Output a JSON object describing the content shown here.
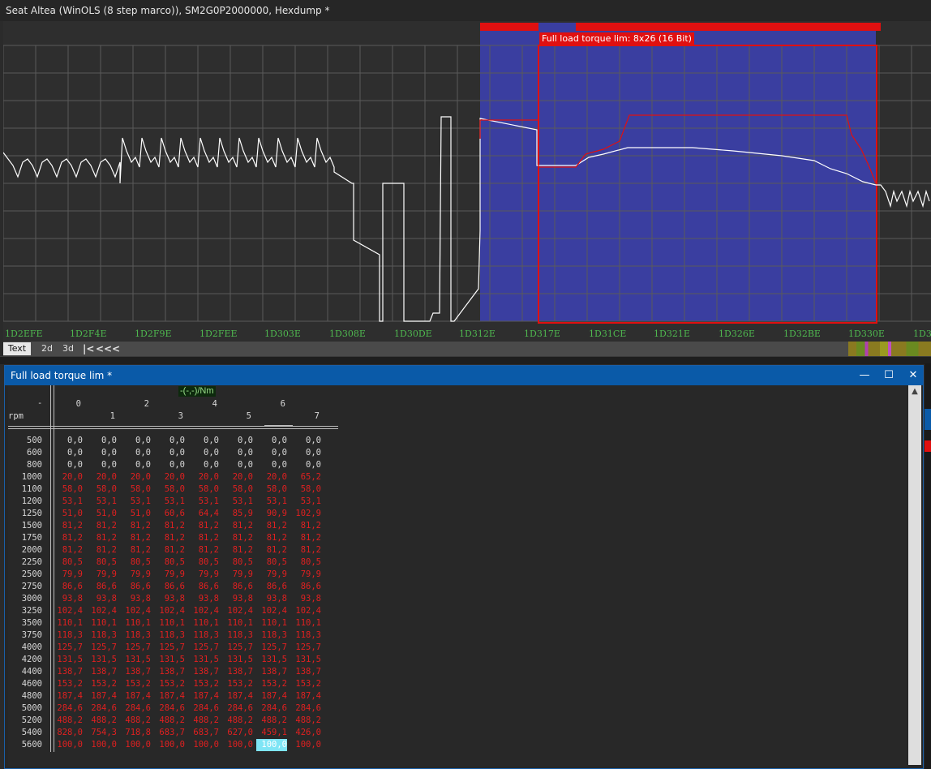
{
  "window_title": "Seat Altea (WinOLS  (8 step marco)), SM2G0P2000000, Hexdump *",
  "hexview": {
    "map_label": "Full load torque lim: 8x26 (16 Bit)",
    "addresses": [
      "1D2EFE",
      "1D2F4E",
      "1D2F9E",
      "1D2FEE",
      "1D303E",
      "1D308E",
      "1D30DE",
      "1D312E",
      "1D317E",
      "1D31CE",
      "1D321E",
      "1D326E",
      "1D32BE",
      "1D330E",
      "1D3"
    ],
    "colors": {
      "selection": "#3a3ea0",
      "map_frame": "#e01010",
      "curve": "#ffffff",
      "grid": "#5a5a5a"
    }
  },
  "view_tabs": {
    "tabs": [
      "Text",
      "2d",
      "3d"
    ],
    "active": "Text",
    "nav": [
      "|<",
      "<<",
      "<"
    ]
  },
  "map_window": {
    "title": "Full load torque lim *",
    "unit": "-(-,-)/Nm",
    "corner": "-",
    "row_axis_label": "rpm",
    "columns_top": [
      "0",
      "2",
      "4",
      "6"
    ],
    "columns_bottom": [
      "1",
      "3",
      "5",
      "7"
    ],
    "buttons": {
      "minimize": "—",
      "maximize": "☐",
      "close": "✕"
    },
    "rows": [
      {
        "rpm": "500",
        "values": [
          "0,0",
          "0,0",
          "0,0",
          "0,0",
          "0,0",
          "0,0",
          "0,0",
          "0,0"
        ],
        "changed": false
      },
      {
        "rpm": "600",
        "values": [
          "0,0",
          "0,0",
          "0,0",
          "0,0",
          "0,0",
          "0,0",
          "0,0",
          "0,0"
        ],
        "changed": false
      },
      {
        "rpm": "800",
        "values": [
          "0,0",
          "0,0",
          "0,0",
          "0,0",
          "0,0",
          "0,0",
          "0,0",
          "0,0"
        ],
        "changed": false
      },
      {
        "rpm": "1000",
        "values": [
          "20,0",
          "20,0",
          "20,0",
          "20,0",
          "20,0",
          "20,0",
          "20,0",
          "65,2"
        ],
        "changed": true
      },
      {
        "rpm": "1100",
        "values": [
          "58,0",
          "58,0",
          "58,0",
          "58,0",
          "58,0",
          "58,0",
          "58,0",
          "58,0"
        ],
        "changed": true
      },
      {
        "rpm": "1200",
        "values": [
          "53,1",
          "53,1",
          "53,1",
          "53,1",
          "53,1",
          "53,1",
          "53,1",
          "53,1"
        ],
        "changed": true
      },
      {
        "rpm": "1250",
        "values": [
          "51,0",
          "51,0",
          "51,0",
          "60,6",
          "64,4",
          "85,9",
          "90,9",
          "102,9"
        ],
        "changed": true
      },
      {
        "rpm": "1500",
        "values": [
          "81,2",
          "81,2",
          "81,2",
          "81,2",
          "81,2",
          "81,2",
          "81,2",
          "81,2"
        ],
        "changed": true
      },
      {
        "rpm": "1750",
        "values": [
          "81,2",
          "81,2",
          "81,2",
          "81,2",
          "81,2",
          "81,2",
          "81,2",
          "81,2"
        ],
        "changed": true
      },
      {
        "rpm": "2000",
        "values": [
          "81,2",
          "81,2",
          "81,2",
          "81,2",
          "81,2",
          "81,2",
          "81,2",
          "81,2"
        ],
        "changed": true
      },
      {
        "rpm": "2250",
        "values": [
          "80,5",
          "80,5",
          "80,5",
          "80,5",
          "80,5",
          "80,5",
          "80,5",
          "80,5"
        ],
        "changed": true
      },
      {
        "rpm": "2500",
        "values": [
          "79,9",
          "79,9",
          "79,9",
          "79,9",
          "79,9",
          "79,9",
          "79,9",
          "79,9"
        ],
        "changed": true
      },
      {
        "rpm": "2750",
        "values": [
          "86,6",
          "86,6",
          "86,6",
          "86,6",
          "86,6",
          "86,6",
          "86,6",
          "86,6"
        ],
        "changed": true
      },
      {
        "rpm": "3000",
        "values": [
          "93,8",
          "93,8",
          "93,8",
          "93,8",
          "93,8",
          "93,8",
          "93,8",
          "93,8"
        ],
        "changed": true
      },
      {
        "rpm": "3250",
        "values": [
          "102,4",
          "102,4",
          "102,4",
          "102,4",
          "102,4",
          "102,4",
          "102,4",
          "102,4"
        ],
        "changed": true
      },
      {
        "rpm": "3500",
        "values": [
          "110,1",
          "110,1",
          "110,1",
          "110,1",
          "110,1",
          "110,1",
          "110,1",
          "110,1"
        ],
        "changed": true
      },
      {
        "rpm": "3750",
        "values": [
          "118,3",
          "118,3",
          "118,3",
          "118,3",
          "118,3",
          "118,3",
          "118,3",
          "118,3"
        ],
        "changed": true
      },
      {
        "rpm": "4000",
        "values": [
          "125,7",
          "125,7",
          "125,7",
          "125,7",
          "125,7",
          "125,7",
          "125,7",
          "125,7"
        ],
        "changed": true
      },
      {
        "rpm": "4200",
        "values": [
          "131,5",
          "131,5",
          "131,5",
          "131,5",
          "131,5",
          "131,5",
          "131,5",
          "131,5"
        ],
        "changed": true
      },
      {
        "rpm": "4400",
        "values": [
          "138,7",
          "138,7",
          "138,7",
          "138,7",
          "138,7",
          "138,7",
          "138,7",
          "138,7"
        ],
        "changed": true
      },
      {
        "rpm": "4600",
        "values": [
          "153,2",
          "153,2",
          "153,2",
          "153,2",
          "153,2",
          "153,2",
          "153,2",
          "153,2"
        ],
        "changed": true
      },
      {
        "rpm": "4800",
        "values": [
          "187,4",
          "187,4",
          "187,4",
          "187,4",
          "187,4",
          "187,4",
          "187,4",
          "187,4"
        ],
        "changed": true
      },
      {
        "rpm": "5000",
        "values": [
          "284,6",
          "284,6",
          "284,6",
          "284,6",
          "284,6",
          "284,6",
          "284,6",
          "284,6"
        ],
        "changed": true
      },
      {
        "rpm": "5200",
        "values": [
          "488,2",
          "488,2",
          "488,2",
          "488,2",
          "488,2",
          "488,2",
          "488,2",
          "488,2"
        ],
        "changed": true
      },
      {
        "rpm": "5400",
        "values": [
          "828,0",
          "754,3",
          "718,8",
          "683,7",
          "683,7",
          "627,0",
          "459,1",
          "426,0"
        ],
        "changed": true
      },
      {
        "rpm": "5600",
        "values": [
          "100,0",
          "100,0",
          "100,0",
          "100,0",
          "100,0",
          "100,0",
          "100,0",
          "100,0"
        ],
        "changed": true,
        "selected_col": 6
      }
    ]
  }
}
